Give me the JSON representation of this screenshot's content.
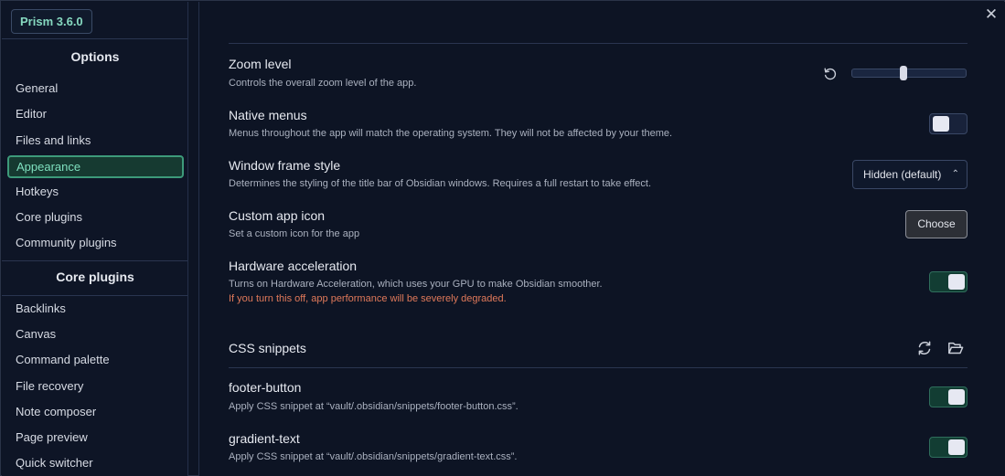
{
  "app": {
    "version_badge": "Prism 3.6.0"
  },
  "sidebar": {
    "options_header": "Options",
    "options_items": [
      {
        "label": "General"
      },
      {
        "label": "Editor"
      },
      {
        "label": "Files and links"
      },
      {
        "label": "Appearance",
        "active": true
      },
      {
        "label": "Hotkeys"
      },
      {
        "label": "Core plugins"
      },
      {
        "label": "Community plugins"
      }
    ],
    "core_header": "Core plugins",
    "core_items": [
      {
        "label": "Backlinks"
      },
      {
        "label": "Canvas"
      },
      {
        "label": "Command palette"
      },
      {
        "label": "File recovery"
      },
      {
        "label": "Note composer"
      },
      {
        "label": "Page preview"
      },
      {
        "label": "Quick switcher"
      }
    ]
  },
  "main": {
    "close_icon": "close-icon",
    "settings": {
      "zoom": {
        "name": "Zoom level",
        "desc": "Controls the overall zoom level of the app.",
        "slider_fraction": 0.45
      },
      "native_menus": {
        "name": "Native menus",
        "desc": "Menus throughout the app will match the operating system. They will not be affected by your theme.",
        "enabled": false
      },
      "window_frame": {
        "name": "Window frame style",
        "desc": "Determines the styling of the title bar of Obsidian windows. Requires a full restart to take effect.",
        "selected": "Hidden (default)"
      },
      "custom_icon": {
        "name": "Custom app icon",
        "desc": "Set a custom icon for the app",
        "button": "Choose"
      },
      "hardware_accel": {
        "name": "Hardware acceleration",
        "desc": "Turns on Hardware Acceleration, which uses your GPU to make Obsidian smoother.",
        "warning": "If you turn this off, app performance will be severely degraded.",
        "enabled": true
      }
    },
    "snippets": {
      "header": "CSS snippets",
      "items": [
        {
          "name": "footer-button",
          "desc": "Apply CSS snippet at “vault/.obsidian/snippets/footer-button.css”.",
          "enabled": true
        },
        {
          "name": "gradient-text",
          "desc": "Apply CSS snippet at “vault/.obsidian/snippets/gradient-text.css”.",
          "enabled": true
        }
      ]
    }
  },
  "colors": {
    "accent": "#3d9a7a",
    "warning": "#e0795a",
    "toggle_on": "#123d33"
  }
}
